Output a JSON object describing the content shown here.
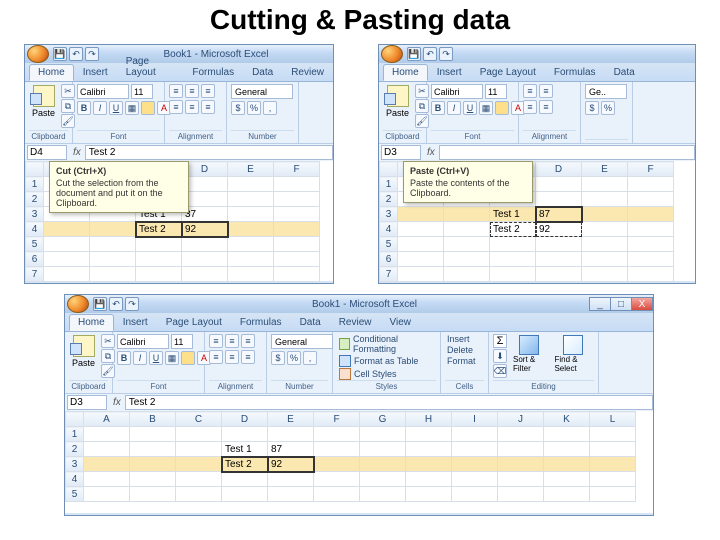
{
  "slide_title": "Cutting & Pasting data",
  "app_title": "Book1 - Microsoft Excel",
  "tabs": [
    "Home",
    "Insert",
    "Page Layout",
    "Formulas",
    "Data",
    "Review",
    "View"
  ],
  "groups": {
    "clipboard": "Clipboard",
    "font": "Font",
    "alignment": "Alignment",
    "number": "Number",
    "styles": "Styles",
    "cells": "Cells",
    "editing": "Editing"
  },
  "clipboard": {
    "paste": "Paste"
  },
  "font": {
    "name": "Calibri",
    "size": "11",
    "bold": "B",
    "italic": "I",
    "underline": "U"
  },
  "number": {
    "format": "General",
    "currency": "$",
    "percent": "%",
    "comma": ","
  },
  "styles": {
    "cond": "Conditional Formatting",
    "table": "Format as Table",
    "cell": "Cell Styles"
  },
  "cells": {
    "insert": "Insert",
    "delete": "Delete",
    "format": "Format"
  },
  "editing": {
    "sort": "Sort & Filter",
    "find": "Find & Select"
  },
  "tooltip_cut": {
    "title": "Cut (Ctrl+X)",
    "body": "Cut the selection from the document and put it on the Clipboard."
  },
  "tooltip_paste": {
    "title": "Paste (Ctrl+V)",
    "body": "Paste the contents of the Clipboard."
  },
  "left": {
    "namebox": "D4",
    "fx": "Test 2",
    "cells": {
      "C3": "Test 1",
      "D3": "37",
      "C4": "Test 2",
      "D4": "92"
    }
  },
  "right": {
    "namebox": "D3",
    "fx": "",
    "cells": {
      "C3": "Test 1",
      "D3": "87",
      "C4": "Test 2",
      "D4": "92"
    }
  },
  "bottom": {
    "namebox": "D3",
    "fx": "Test 2",
    "cells": {
      "D2": "Test 1",
      "E2": "87",
      "D3": "Test 2",
      "E3": "92"
    }
  }
}
